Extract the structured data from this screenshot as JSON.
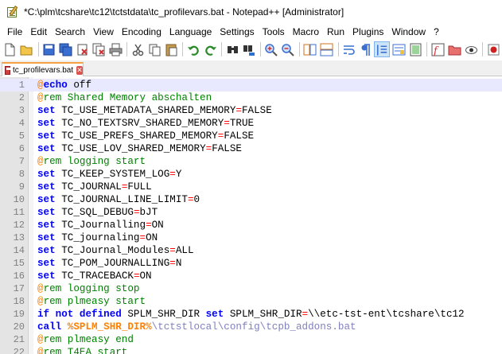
{
  "window": {
    "title": "*C:\\plm\\tcshare\\tc12\\tctstdata\\tc_profilevars.bat - Notepad++ [Administrator]"
  },
  "menu": [
    "File",
    "Edit",
    "Search",
    "View",
    "Encoding",
    "Language",
    "Settings",
    "Tools",
    "Macro",
    "Run",
    "Plugins",
    "Window",
    "?"
  ],
  "toolbar": {
    "icons": [
      "new-file-icon",
      "open-file-icon",
      "save-icon",
      "save-all-icon",
      "close-icon",
      "close-all-icon",
      "print-icon",
      "cut-icon",
      "copy-icon",
      "paste-icon",
      "undo-icon",
      "redo-icon",
      "find-icon",
      "replace-icon",
      "zoom-in-icon",
      "zoom-out-icon",
      "sync-vertical-icon",
      "sync-horizontal-icon",
      "word-wrap-icon",
      "show-all-chars-icon",
      "indent-guide-icon",
      "udl-icon",
      "doc-map-icon",
      "function-list-icon",
      "folder-workspace-icon",
      "monitoring-icon",
      "record-macro-icon"
    ],
    "active_icon": "indent-guide-icon"
  },
  "tab": {
    "label": "tc_profilevars.bat",
    "modified": true
  },
  "colors": {
    "keyword": "#0000ff",
    "label": "#ff8000",
    "comment": "#008000",
    "operator": "#ff0000",
    "text": "#000000",
    "path": "#8080c0",
    "line_number": "#808080",
    "gutter": "#e4e4e4",
    "current_line": "#e8e8ff",
    "tab_accent": "#f5a142"
  },
  "editor": {
    "current_line": 1,
    "lines": [
      {
        "n": "1",
        "tokens": [
          {
            "t": "lbl",
            "v": "@"
          },
          {
            "t": "kw",
            "v": "echo"
          },
          {
            "t": "txt",
            "v": " off"
          }
        ]
      },
      {
        "n": "2",
        "tokens": [
          {
            "t": "lbl",
            "v": "@"
          },
          {
            "t": "cmt",
            "v": "rem Shared Memory abschalten"
          }
        ]
      },
      {
        "n": "3",
        "tokens": [
          {
            "t": "kw",
            "v": "set"
          },
          {
            "t": "txt",
            "v": " TC_USE_METADATA_SHARED_MEMORY"
          },
          {
            "t": "op",
            "v": "="
          },
          {
            "t": "txt",
            "v": "FALSE"
          }
        ]
      },
      {
        "n": "4",
        "tokens": [
          {
            "t": "kw",
            "v": "set"
          },
          {
            "t": "txt",
            "v": " TC_NO_TEXTSRV_SHARED_MEMORY"
          },
          {
            "t": "op",
            "v": "="
          },
          {
            "t": "txt",
            "v": "TRUE"
          }
        ]
      },
      {
        "n": "5",
        "tokens": [
          {
            "t": "kw",
            "v": "set"
          },
          {
            "t": "txt",
            "v": " TC_USE_PREFS_SHARED_MEMORY"
          },
          {
            "t": "op",
            "v": "="
          },
          {
            "t": "txt",
            "v": "FALSE"
          }
        ]
      },
      {
        "n": "6",
        "tokens": [
          {
            "t": "kw",
            "v": "set"
          },
          {
            "t": "txt",
            "v": " TC_USE_LOV_SHARED_MEMORY"
          },
          {
            "t": "op",
            "v": "="
          },
          {
            "t": "txt",
            "v": "FALSE"
          }
        ]
      },
      {
        "n": "7",
        "tokens": [
          {
            "t": "lbl",
            "v": "@"
          },
          {
            "t": "cmt",
            "v": "rem logging start"
          }
        ]
      },
      {
        "n": "8",
        "tokens": [
          {
            "t": "kw",
            "v": "set"
          },
          {
            "t": "txt",
            "v": " TC_KEEP_SYSTEM_LOG"
          },
          {
            "t": "op",
            "v": "="
          },
          {
            "t": "txt",
            "v": "Y"
          }
        ]
      },
      {
        "n": "9",
        "tokens": [
          {
            "t": "kw",
            "v": "set"
          },
          {
            "t": "txt",
            "v": " TC_JOURNAL"
          },
          {
            "t": "op",
            "v": "="
          },
          {
            "t": "txt",
            "v": "FULL"
          }
        ]
      },
      {
        "n": "10",
        "tokens": [
          {
            "t": "kw",
            "v": "set"
          },
          {
            "t": "txt",
            "v": " TC_JOURNAL_LINE_LIMIT"
          },
          {
            "t": "op",
            "v": "="
          },
          {
            "t": "txt",
            "v": "0"
          }
        ]
      },
      {
        "n": "11",
        "tokens": [
          {
            "t": "kw",
            "v": "set"
          },
          {
            "t": "txt",
            "v": " TC_SQL_DEBUG"
          },
          {
            "t": "op",
            "v": "="
          },
          {
            "t": "txt",
            "v": "bJT"
          }
        ]
      },
      {
        "n": "12",
        "tokens": [
          {
            "t": "kw",
            "v": "set"
          },
          {
            "t": "txt",
            "v": " TC_Journalling"
          },
          {
            "t": "op",
            "v": "="
          },
          {
            "t": "txt",
            "v": "ON"
          }
        ]
      },
      {
        "n": "13",
        "tokens": [
          {
            "t": "kw",
            "v": "set"
          },
          {
            "t": "txt",
            "v": " TC_journaling"
          },
          {
            "t": "op",
            "v": "="
          },
          {
            "t": "txt",
            "v": "ON"
          }
        ]
      },
      {
        "n": "14",
        "tokens": [
          {
            "t": "kw",
            "v": "set"
          },
          {
            "t": "txt",
            "v": " TC_Journal_Modules"
          },
          {
            "t": "op",
            "v": "="
          },
          {
            "t": "txt",
            "v": "ALL"
          }
        ]
      },
      {
        "n": "15",
        "tokens": [
          {
            "t": "kw",
            "v": "set"
          },
          {
            "t": "txt",
            "v": " TC_POM_JOURNALLING"
          },
          {
            "t": "op",
            "v": "="
          },
          {
            "t": "txt",
            "v": "N"
          }
        ]
      },
      {
        "n": "16",
        "tokens": [
          {
            "t": "kw",
            "v": "set"
          },
          {
            "t": "txt",
            "v": " TC_TRACEBACK"
          },
          {
            "t": "op",
            "v": "="
          },
          {
            "t": "txt",
            "v": "ON"
          }
        ]
      },
      {
        "n": "17",
        "tokens": [
          {
            "t": "lbl",
            "v": "@"
          },
          {
            "t": "cmt",
            "v": "rem logging stop"
          }
        ]
      },
      {
        "n": "18",
        "tokens": [
          {
            "t": "lbl",
            "v": "@"
          },
          {
            "t": "cmt",
            "v": "rem plmeasy start"
          }
        ]
      },
      {
        "n": "19",
        "tokens": [
          {
            "t": "kw",
            "v": "if not defined"
          },
          {
            "t": "txt",
            "v": " SPLM_SHR_DIR "
          },
          {
            "t": "kw",
            "v": "set"
          },
          {
            "t": "txt",
            "v": " SPLM_SHR_DIR"
          },
          {
            "t": "op",
            "v": "="
          },
          {
            "t": "txt",
            "v": "\\\\etc-tst-ent\\tcshare\\tc12"
          }
        ]
      },
      {
        "n": "20",
        "tokens": [
          {
            "t": "kw",
            "v": "call"
          },
          {
            "t": "txt",
            "v": " "
          },
          {
            "t": "var",
            "v": "%SPLM_SHR_DIR%"
          },
          {
            "t": "path",
            "v": "\\tctstlocal\\config\\tcpb_addons.bat"
          }
        ]
      },
      {
        "n": "21",
        "tokens": [
          {
            "t": "lbl",
            "v": "@"
          },
          {
            "t": "cmt",
            "v": "rem plmeasy end"
          }
        ]
      },
      {
        "n": "22",
        "tokens": [
          {
            "t": "lbl",
            "v": "@"
          },
          {
            "t": "cmt",
            "v": "rem T4EA start"
          }
        ]
      }
    ]
  }
}
